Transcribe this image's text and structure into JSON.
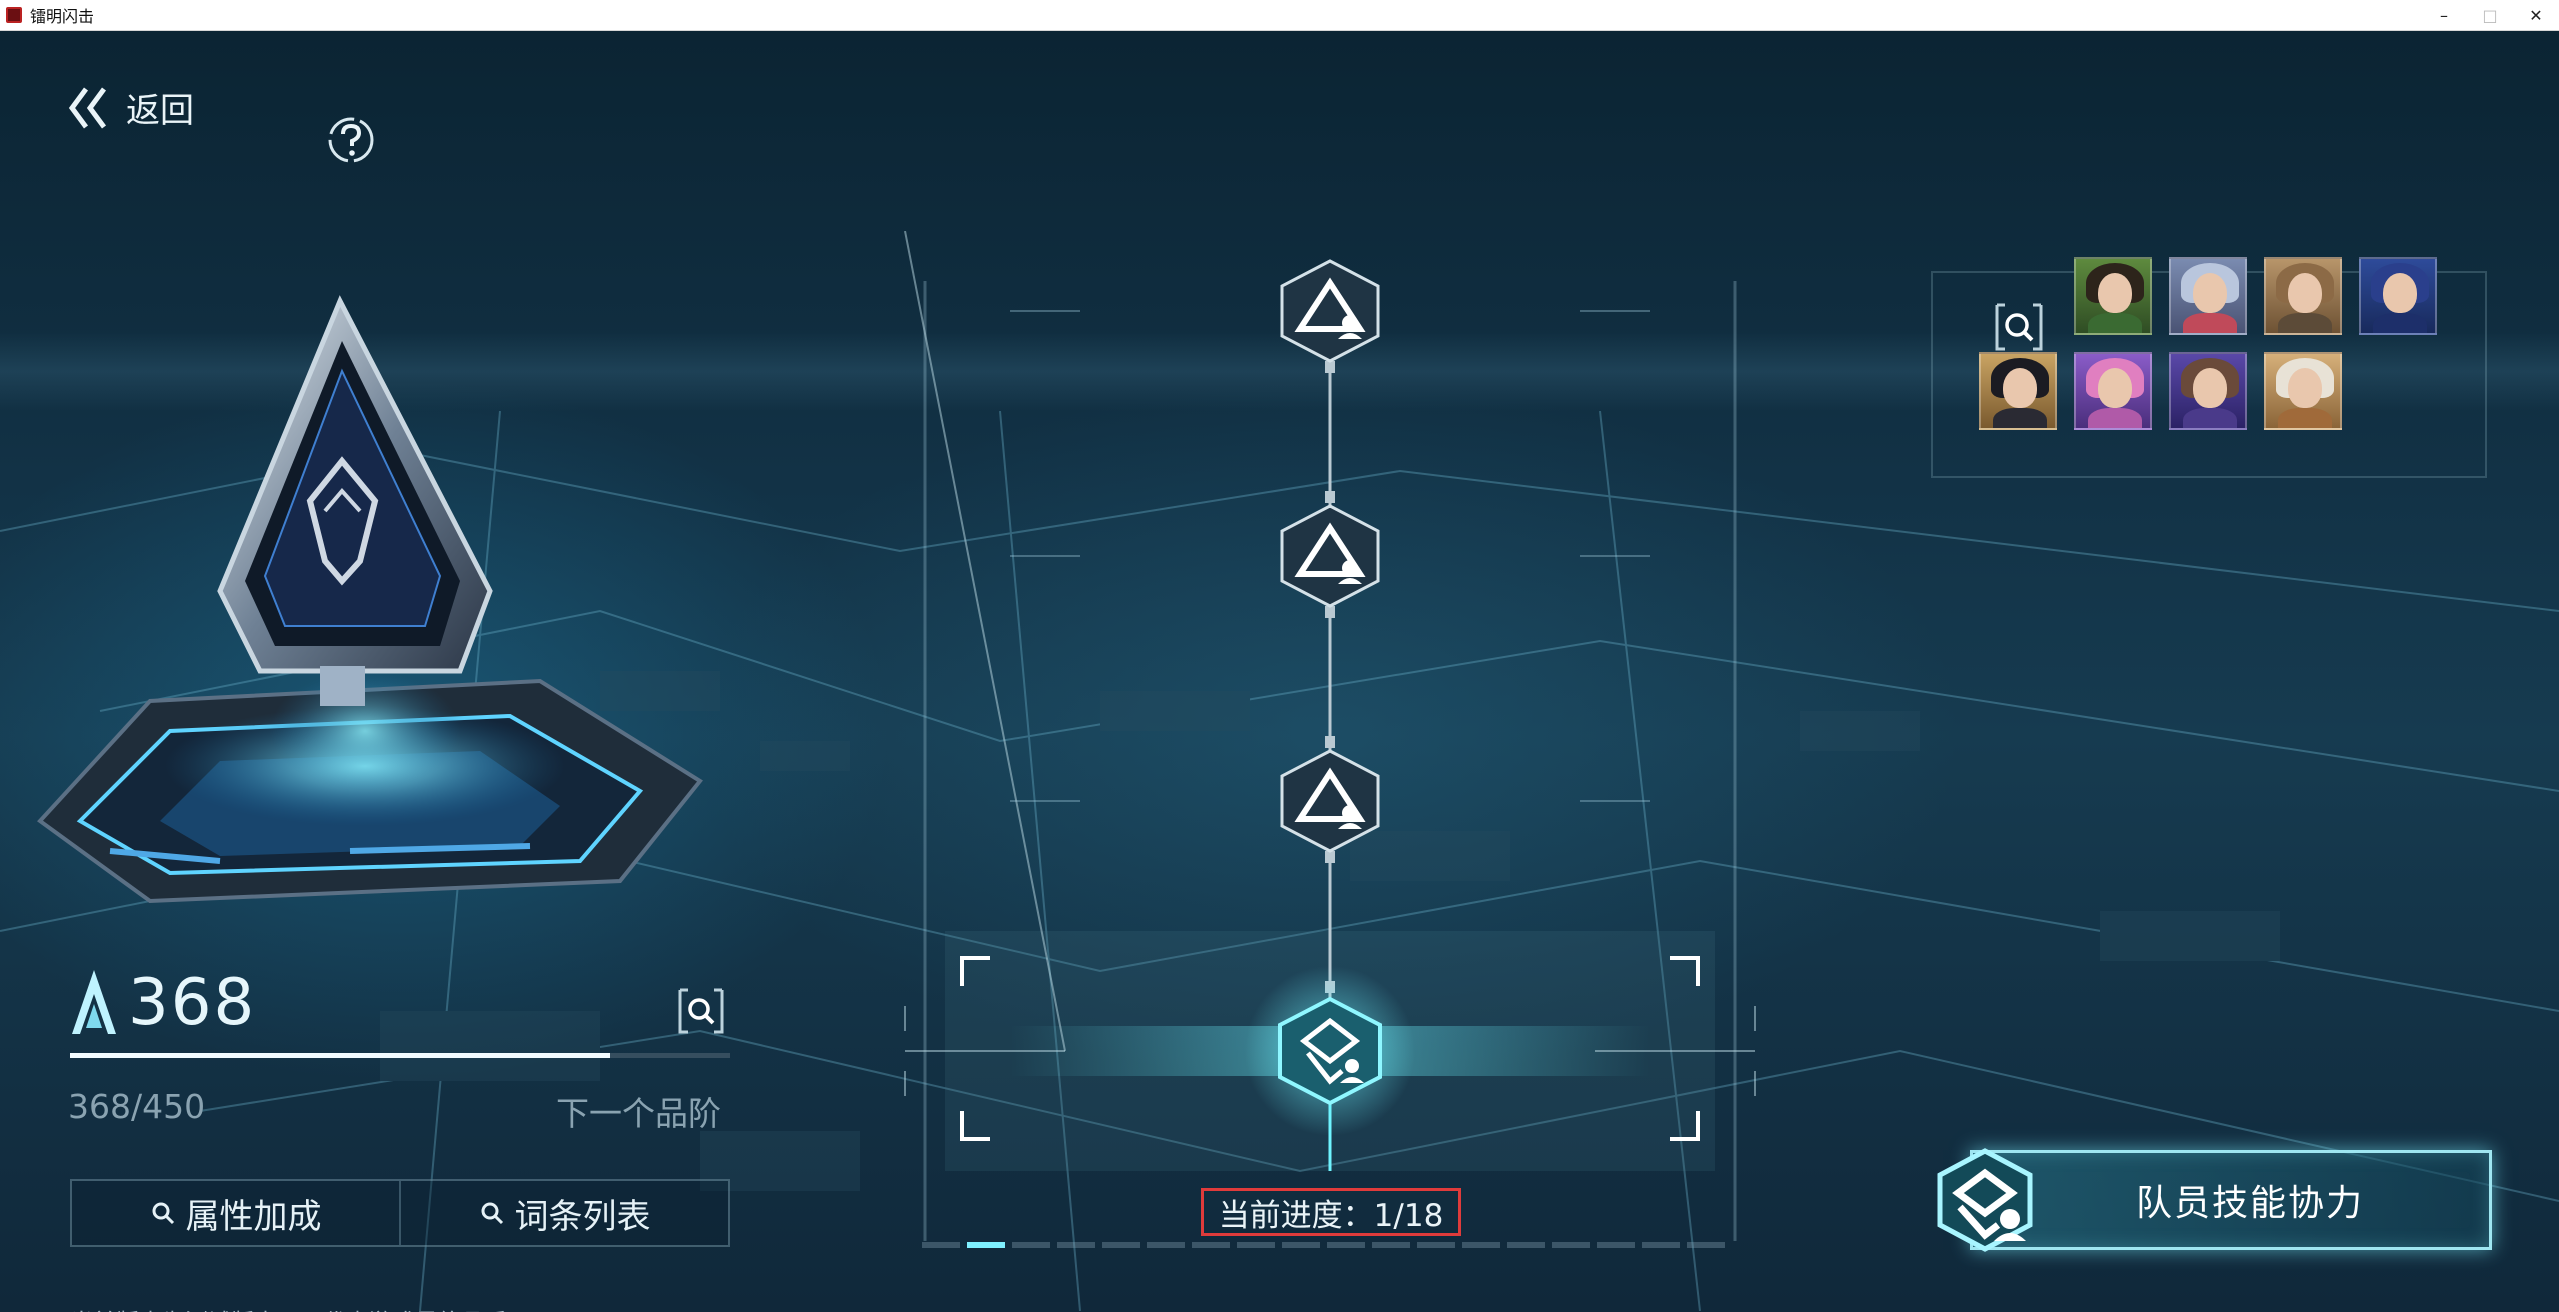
{
  "window": {
    "title": "镭明闪击",
    "minimize": "–",
    "maximize": "□",
    "close": "✕"
  },
  "nav": {
    "back_label": "返回",
    "help_icon": "question-icon"
  },
  "artifact": {
    "score": "368",
    "progress_text": "368/450",
    "progress_fraction": 0.818,
    "next_tier_label": "下一个品阶"
  },
  "tabs": [
    {
      "label": "属性加成",
      "icon": "search-icon"
    },
    {
      "label": "词条列表",
      "icon": "search-icon"
    }
  ],
  "disclaimer": "当前版本为测试版本，不代表游戏最终品质",
  "skill_tree": {
    "progress_label": "当前进度：1/18",
    "current_step": 1,
    "total_steps": 18,
    "page_count": 18,
    "active_page": 2
  },
  "team": {
    "search_icon": "search-icon",
    "portrait_count": 8
  },
  "skill_button": {
    "label": "队员技能协力"
  },
  "colors": {
    "accent": "#7ff0ff",
    "highlight_border": "#e03b3b",
    "text_muted": "#8aa3b1"
  }
}
